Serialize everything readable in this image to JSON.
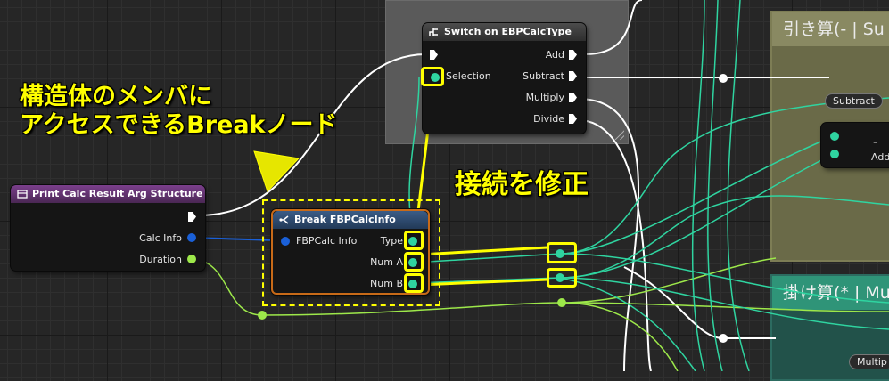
{
  "switch_node": {
    "title": "Switch on EBPCalcType",
    "pins_in": {
      "selection": "Selection"
    },
    "pins_out": [
      "Add",
      "Subtract",
      "Multiply",
      "Divide"
    ]
  },
  "print_node": {
    "title": "Print Calc Result Arg Structure",
    "pins_out": [
      "Calc Info",
      "Duration"
    ]
  },
  "break_node": {
    "title": "Break FBPCalcInfo",
    "pin_in": "FBPCalc Info",
    "pins_out": [
      "Type",
      "Num A",
      "Num B"
    ]
  },
  "frames": {
    "subtract_frame_title": "引き算(- | Su",
    "multiply_frame_title": "掛け算(* | Mu"
  },
  "math_node": {
    "pill_label": "Subtract",
    "operator": "-",
    "sub_label": "Add"
  },
  "multiply_pill": "Multip",
  "annotations": {
    "break_caption_line1": "構造体のメンバに",
    "break_caption_line2": "アクセスできるBreakノード",
    "fix_caption": "接続を修正"
  },
  "colors": {
    "exec_wire": "#ffffff",
    "struct_pin": "#1a60d8",
    "float_pin": "#9de84a",
    "enum_pin": "#2fd4a0",
    "annotation": "#ffff00",
    "break_border": "#c86a18"
  }
}
